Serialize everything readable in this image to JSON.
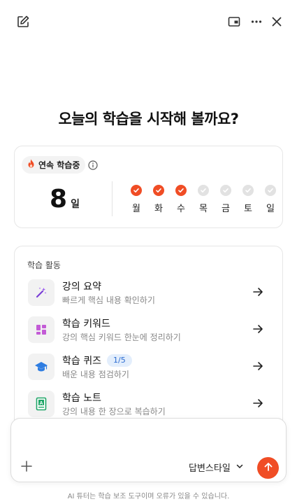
{
  "header": {
    "edit_icon": "edit-icon",
    "pip_icon": "picture-in-picture-icon",
    "more_icon": "more-horizontal-icon",
    "close_icon": "close-icon"
  },
  "headline": "오늘의 학습을 시작해 볼까요?",
  "streak": {
    "label": "연속 학습중",
    "count": "8",
    "unit": "일",
    "accent_color": "#f04d25",
    "days": [
      {
        "label": "월",
        "done": true
      },
      {
        "label": "화",
        "done": true
      },
      {
        "label": "수",
        "done": true
      },
      {
        "label": "목",
        "done": false
      },
      {
        "label": "금",
        "done": false
      },
      {
        "label": "토",
        "done": false
      },
      {
        "label": "일",
        "done": false
      }
    ]
  },
  "activities": {
    "title": "학습 활동",
    "items": [
      {
        "title": "강의 요약",
        "subtitle": "빠르게 핵심 내용 확인하기",
        "icon": "magic-wand-icon"
      },
      {
        "title": "학습 키워드",
        "subtitle": "강의 핵심 키워드 한눈에 정리하기",
        "icon": "grid-layout-icon"
      },
      {
        "title": "학습 퀴즈",
        "badge": "1/5",
        "subtitle": "배운 내용 점검하기",
        "icon": "graduation-cap-icon"
      },
      {
        "title": "학습 노트",
        "subtitle": "강의 내용 한 장으로 복습하기",
        "icon": "note-icon"
      }
    ]
  },
  "composer": {
    "answer_style_label": "답변스타일",
    "send_color": "#f04d25"
  },
  "disclaimer": "AI 튜터는 학습 보조 도구이며 오류가 있을 수 있습니다."
}
